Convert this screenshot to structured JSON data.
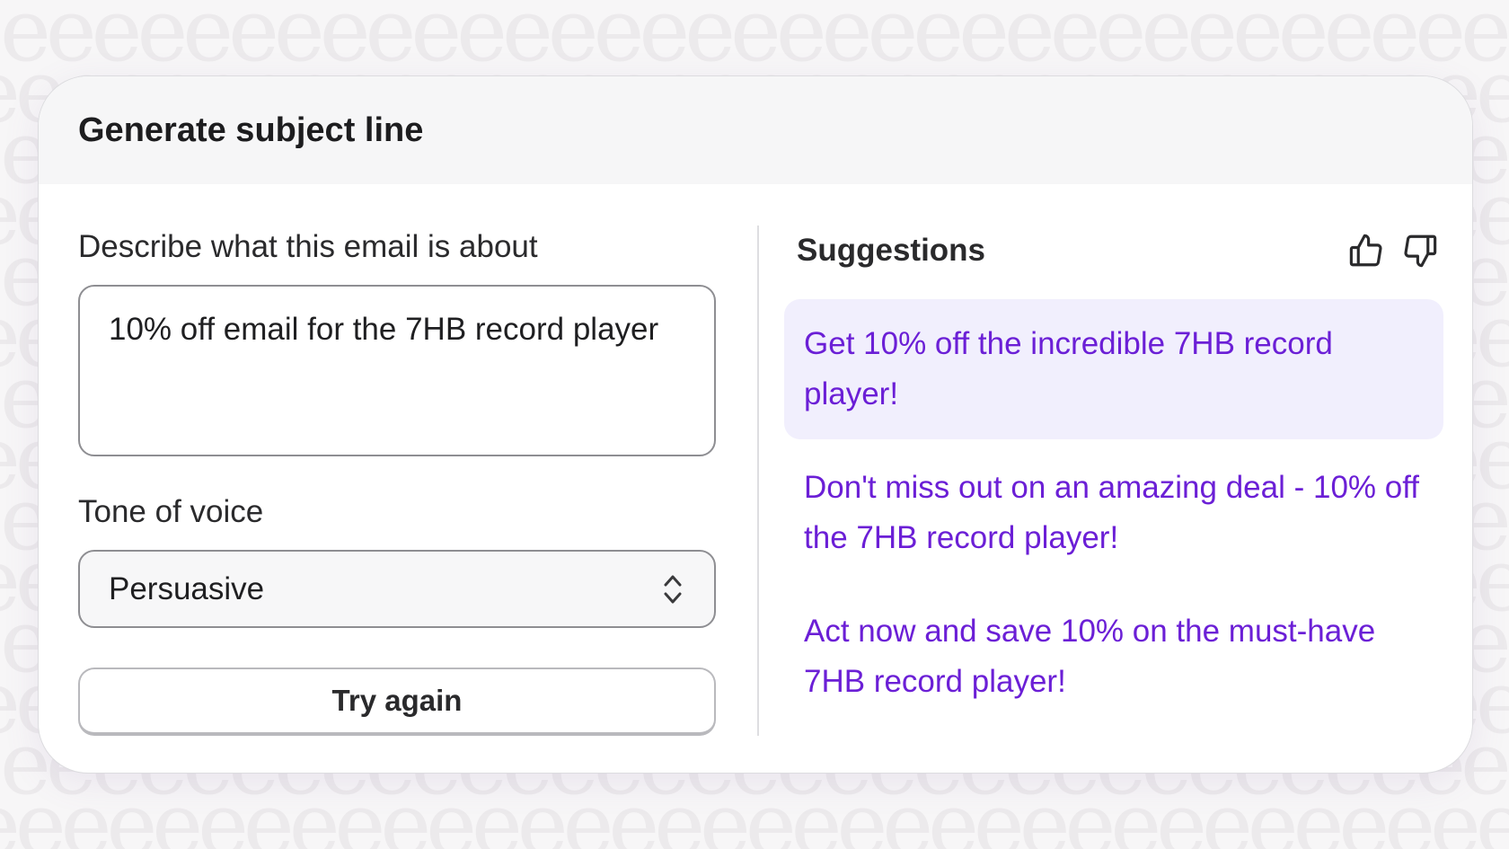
{
  "background": {
    "pattern_glyph": "e",
    "color": "#f7f6f7"
  },
  "header": {
    "title": "Generate subject line"
  },
  "form": {
    "description_label": "Describe what this email is about",
    "description_value": "10% off email for the 7HB record player",
    "tone_label": "Tone of voice",
    "tone_value": "Persuasive",
    "try_again_label": "Try again"
  },
  "suggestions": {
    "title": "Suggestions",
    "thumbs_up_icon": "thumbs-up-icon",
    "thumbs_down_icon": "thumbs-down-icon",
    "items": [
      "Get 10% off the incredible 7HB record player!",
      "Don't miss out on an amazing deal - 10% off the 7HB record player!",
      "Act now and save 10% on the must-have 7HB record player!"
    ]
  },
  "colors": {
    "suggestion_text": "#6b1fd6",
    "suggestion_highlight": "#f1effd"
  }
}
